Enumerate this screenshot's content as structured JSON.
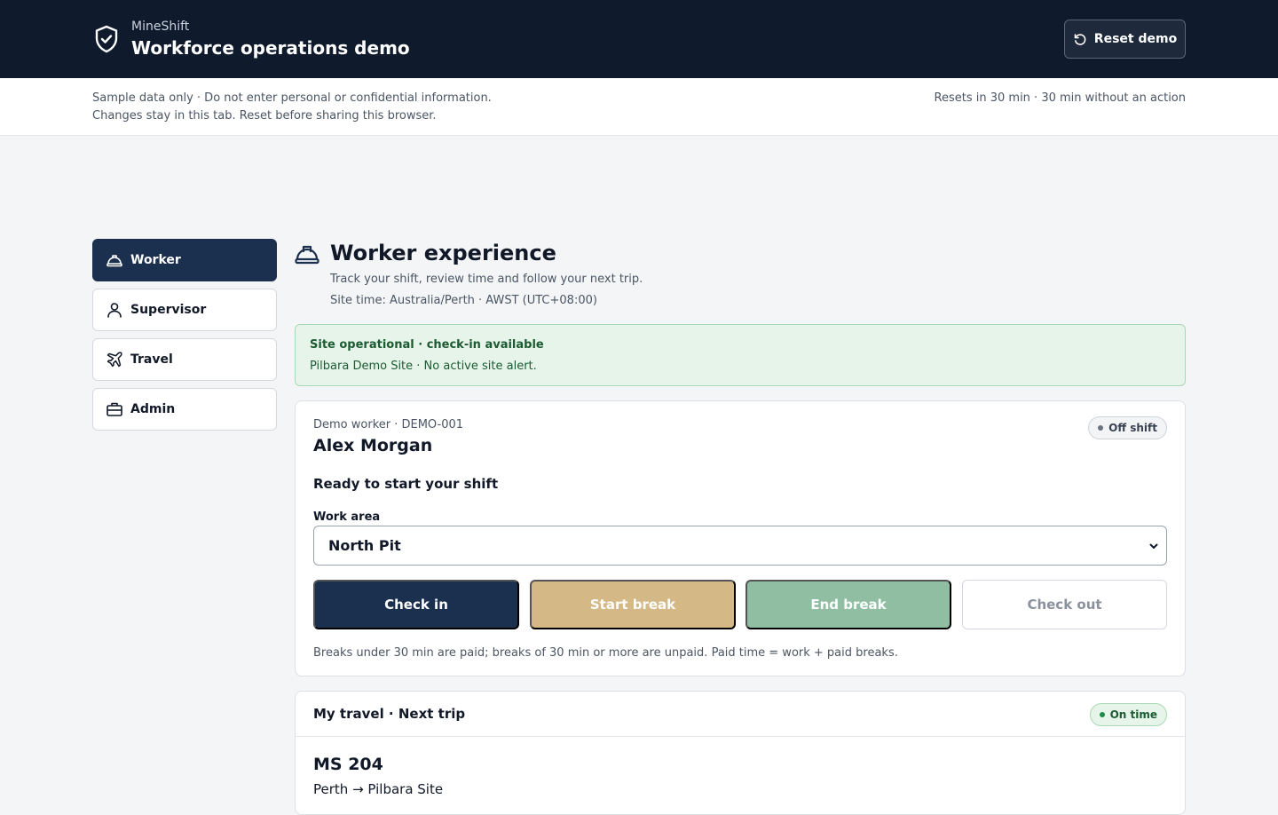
{
  "header": {
    "brand_small": "MineShift",
    "title": "Workforce operations demo",
    "reset_label": "Reset demo",
    "brand_icon": "shield-check-icon",
    "reset_icon": "rotate-ccw-icon"
  },
  "notice": {
    "line1": "Sample data only · Do not enter personal or confidential information.",
    "line2": "Changes stay in this tab. Reset before sharing this browser.",
    "reset_info": "Resets in 30 min · 30 min without an action"
  },
  "sidebar": {
    "items": [
      {
        "label": "Worker",
        "icon": "hard-hat-icon",
        "active": true
      },
      {
        "label": "Supervisor",
        "icon": "user-icon",
        "active": false
      },
      {
        "label": "Travel",
        "icon": "plane-icon",
        "active": false
      },
      {
        "label": "Admin",
        "icon": "briefcase-icon",
        "active": false
      }
    ]
  },
  "main": {
    "title": "Worker experience",
    "subtitle": "Track your shift, review time and follow your next trip.",
    "site_time": "Site time: Australia/Perth · AWST (UTC+08:00)"
  },
  "alert": {
    "title": "Site operational · check-in available",
    "body": "Pilbara Demo Site · No active site alert."
  },
  "worker_card": {
    "worker_id": "Demo worker · DEMO-001",
    "name": "Alex Morgan",
    "status": "Off shift",
    "ready_text": "Ready to start your shift",
    "work_area_label": "Work area",
    "work_area_value": "North Pit",
    "buttons": {
      "check_in": "Check in",
      "start_break": "Start break",
      "end_break": "End break",
      "check_out": "Check out"
    },
    "break_note": "Breaks under 30 min are paid; breaks of 30 min or more are unpaid. Paid time = work + paid breaks."
  },
  "travel_card": {
    "title": "My travel · Next trip",
    "status": "On time",
    "flight": "MS 204",
    "route": "Perth → Pilbara Site"
  },
  "colors": {
    "header_bg": "#0f1b2d",
    "primary": "#1b2f4e",
    "break_start": "#d4b886",
    "break_end": "#8fbea2",
    "success_bg": "#e6f4ea",
    "success_text": "#1c5b32"
  }
}
